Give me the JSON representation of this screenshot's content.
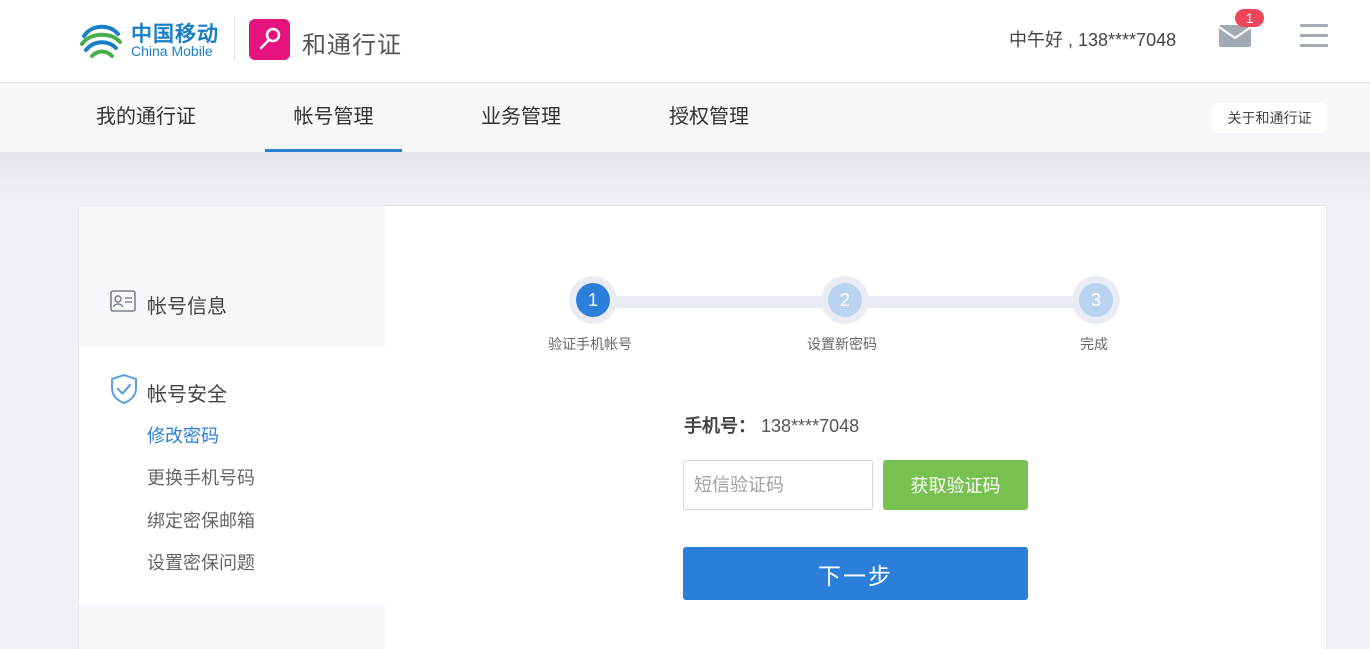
{
  "header": {
    "logo_cn": "中国移动",
    "logo_en": "China Mobile",
    "app_title": "和通行证",
    "greeting": "中午好 , 138****7048",
    "mail_count": "1",
    "icons": {
      "logo": "china-mobile-logo",
      "app": "key-icon",
      "mail": "mail-icon",
      "menu": "hamburger-menu-icon"
    }
  },
  "nav": {
    "tabs": [
      {
        "label": "我的通行证",
        "active": false
      },
      {
        "label": "帐号管理",
        "active": true
      },
      {
        "label": "业务管理",
        "active": false
      },
      {
        "label": "授权管理",
        "active": false
      }
    ],
    "about": "关于和通行证"
  },
  "sidebar": {
    "account_info": "帐号信息",
    "account_security": "帐号安全",
    "security_items": [
      {
        "label": "修改密码",
        "active": true
      },
      {
        "label": "更换手机号码",
        "active": false
      },
      {
        "label": "绑定密保邮箱",
        "active": false
      },
      {
        "label": "设置密保问题",
        "active": false
      }
    ],
    "icons": {
      "account_info": "id-card-icon",
      "account_security": "shield-check-icon"
    }
  },
  "steps": [
    {
      "number": "1",
      "label": "验证手机帐号",
      "active": true
    },
    {
      "number": "2",
      "label": "设置新密码",
      "active": false
    },
    {
      "number": "3",
      "label": "完成",
      "active": false
    }
  ],
  "form": {
    "phone_label": "手机号：",
    "phone_value": "138****7048",
    "sms_placeholder": "短信验证码",
    "sms_value": "",
    "get_code_label": "获取验证码",
    "next_label": "下一步"
  },
  "colors": {
    "primary": "#2c7fd8",
    "green": "#76c14f",
    "brand_pink": "#e6137e",
    "brand_blue": "#1a7fc7",
    "badge_red": "#f0465a",
    "step_inactive": "#b9d3f1"
  }
}
